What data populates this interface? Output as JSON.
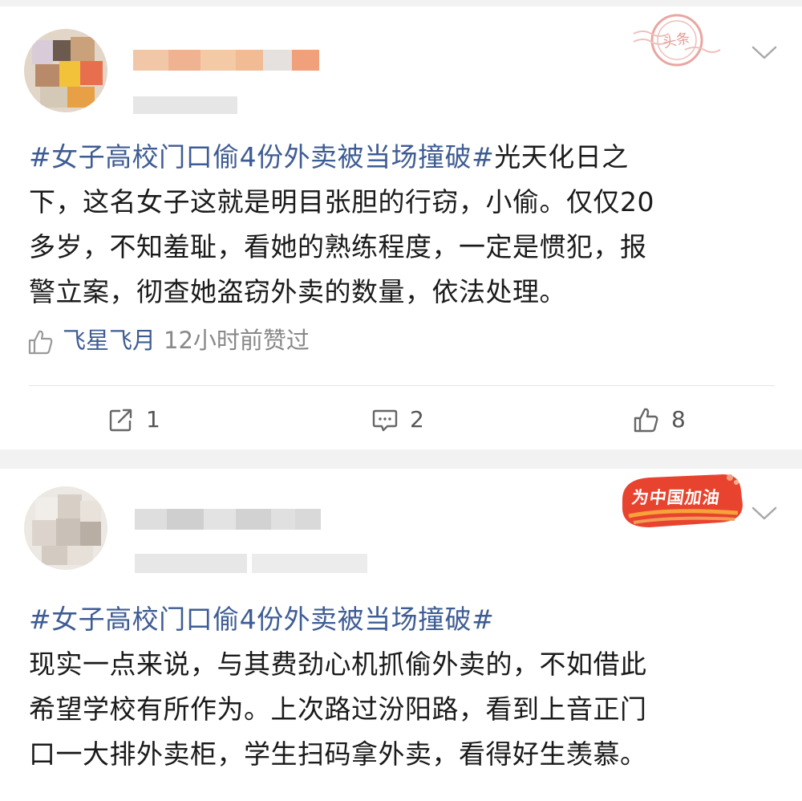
{
  "posts": [
    {
      "topic": "#女子高校门口偷4份外卖被当场撞破#",
      "lines": [
        "光天化日之",
        "下，这名女子这就是明目张胆的行窃，小偷。仅仅20",
        "多岁，不知羞耻，看她的熟练程度，一定是惯犯，报",
        "警立案，彻查她盗窃外卖的数量，依法处理。"
      ],
      "liked_by": {
        "name": "飞星飞月",
        "time": "12小时前赞过"
      },
      "stamp_text": "头条",
      "actions": {
        "repost_count": "1",
        "comment_count": "2",
        "like_count": "8"
      }
    },
    {
      "topic": "#女子高校门口偷4份外卖被当场撞破#",
      "lines": [
        "现实一点来说，与其费劲心机抓偷外卖的，不如借此",
        "希望学校有所作为。上次路过汾阳路，看到上音正门",
        "口一大排外卖柜，学生扫码拿外卖，看得好生羡慕。"
      ],
      "badge_text": "为中国加油"
    }
  ],
  "colors": {
    "topic": "#3e5c94",
    "text": "#1a1a1a",
    "muted": "#888888",
    "gap": "#f2f2f2",
    "badge": "#e8432e"
  },
  "icons": {
    "more": "chevron-down-icon",
    "like": "thumbs-up-icon",
    "repost": "repost-icon",
    "comment": "comment-icon"
  }
}
